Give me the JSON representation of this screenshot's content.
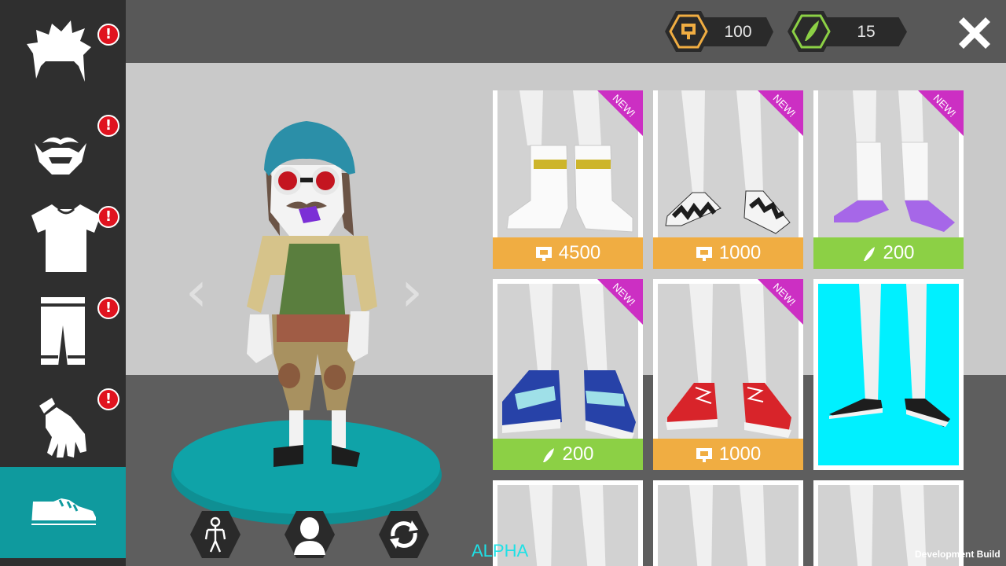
{
  "currencies": {
    "coins": {
      "value": "100",
      "color": "#f0ad42",
      "icon": "coin-icon"
    },
    "feathers": {
      "value": "15",
      "color": "#8cd045",
      "icon": "feather-icon"
    }
  },
  "sidebar": {
    "categories": [
      {
        "name": "hair",
        "icon": "hair-icon",
        "alert": "!",
        "active": false
      },
      {
        "name": "beard",
        "icon": "beard-icon",
        "alert": "!",
        "active": false
      },
      {
        "name": "shirt",
        "icon": "shirt-icon",
        "alert": "!",
        "active": false
      },
      {
        "name": "pants",
        "icon": "pants-icon",
        "alert": "!",
        "active": false
      },
      {
        "name": "gloves",
        "icon": "glove-icon",
        "alert": "!",
        "active": false
      },
      {
        "name": "shoes",
        "icon": "shoe-icon",
        "alert": "",
        "active": true
      }
    ]
  },
  "preview": {
    "prev_arrow": "‹",
    "next_arrow": "›",
    "buttons": [
      {
        "icon": "body-icon"
      },
      {
        "icon": "head-icon"
      },
      {
        "icon": "rotate-icon"
      }
    ]
  },
  "items": [
    {
      "new_label": "NEW!",
      "price": "4500",
      "currency": "coin",
      "shoe": "white-boots"
    },
    {
      "new_label": "NEW!",
      "price": "1000",
      "currency": "coin",
      "shoe": "checkered-slip-ons"
    },
    {
      "new_label": "NEW!",
      "price": "200",
      "currency": "feather",
      "shoe": "purple-flats"
    },
    {
      "new_label": "NEW!",
      "price": "200",
      "currency": "feather",
      "shoe": "blue-velcro-sneakers"
    },
    {
      "new_label": "NEW!",
      "price": "1000",
      "currency": "coin",
      "shoe": "red-high-tops"
    },
    {
      "new_label": "",
      "price": "",
      "currency": "",
      "shoe": "black-sneakers",
      "selected": true
    }
  ],
  "footer": {
    "alpha": "ALPHA",
    "dev_build": "Development Build"
  },
  "colors": {
    "accent": "#0f9a9e",
    "selected": "#00f0ff",
    "new_ribbon": "#cc2fc3",
    "alert": "#e0131f"
  }
}
